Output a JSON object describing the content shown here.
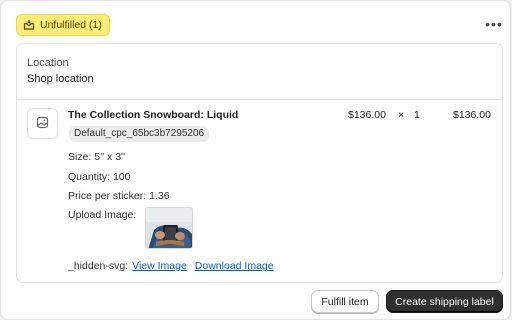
{
  "status_badge": {
    "label": "Unfulfilled (1)",
    "icon": "fulfillment-box-icon",
    "color": "#ffeb78"
  },
  "more_menu": {
    "icon": "more-horizontal-icon",
    "glyph": "•••"
  },
  "location": {
    "label": "Location",
    "value": "Shop location"
  },
  "line_item": {
    "title": "The Collection Snowboard: Liquid",
    "sku": "Default_cpc_65bc3b7295206",
    "unit_price": "$136.00",
    "times": "×",
    "quantity": "1",
    "total": "$136.00",
    "properties": {
      "size": "Size: 5'' x 3''",
      "quantity": "Quantity: 100",
      "price_per_sticker": "Price per sticker: 1.36",
      "upload_image": "Upload Image:",
      "hidden_svg": "_hidden-svg:"
    },
    "view_image_link": "View Image",
    "download_image_link": "Download Image"
  },
  "actions": {
    "fulfill_label": "Fulfill item",
    "create_label": "Create shipping label",
    "primary_color": "#303030",
    "link_color": "#005bd3"
  }
}
